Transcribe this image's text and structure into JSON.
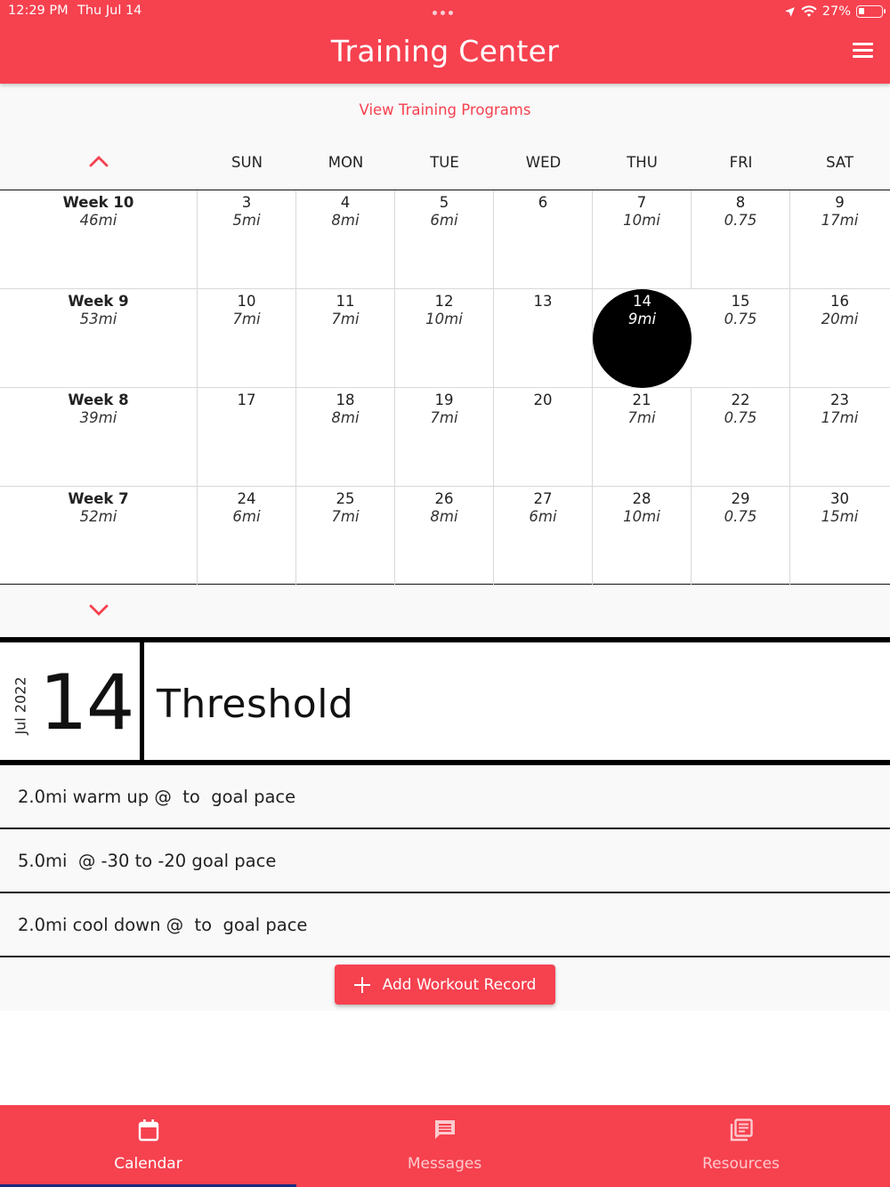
{
  "status_bar": {
    "time": "12:29 PM",
    "date": "Thu Jul 14",
    "battery": "27%"
  },
  "header": {
    "title": "Training Center",
    "menu_icon": "hamburger-menu-icon"
  },
  "calendar": {
    "view_programs_link": "View Training Programs",
    "days_of_week": [
      "SUN",
      "MON",
      "TUE",
      "WED",
      "THU",
      "FRI",
      "SAT"
    ],
    "weeks": [
      {
        "label": "Week 10",
        "total": "46mi",
        "days": [
          {
            "num": "3",
            "dist": "5mi"
          },
          {
            "num": "4",
            "dist": "8mi"
          },
          {
            "num": "5",
            "dist": "6mi"
          },
          {
            "num": "6",
            "dist": ""
          },
          {
            "num": "7",
            "dist": "10mi"
          },
          {
            "num": "8",
            "dist": "0.75"
          },
          {
            "num": "9",
            "dist": "17mi"
          }
        ]
      },
      {
        "label": "Week 9",
        "total": "53mi",
        "days": [
          {
            "num": "10",
            "dist": "7mi"
          },
          {
            "num": "11",
            "dist": "7mi"
          },
          {
            "num": "12",
            "dist": "10mi"
          },
          {
            "num": "13",
            "dist": ""
          },
          {
            "num": "14",
            "dist": "9mi",
            "selected": true
          },
          {
            "num": "15",
            "dist": "0.75"
          },
          {
            "num": "16",
            "dist": "20mi"
          }
        ]
      },
      {
        "label": "Week 8",
        "total": "39mi",
        "days": [
          {
            "num": "17",
            "dist": ""
          },
          {
            "num": "18",
            "dist": "8mi"
          },
          {
            "num": "19",
            "dist": "7mi"
          },
          {
            "num": "20",
            "dist": ""
          },
          {
            "num": "21",
            "dist": "7mi"
          },
          {
            "num": "22",
            "dist": "0.75"
          },
          {
            "num": "23",
            "dist": "17mi"
          }
        ]
      },
      {
        "label": "Week 7",
        "total": "52mi",
        "days": [
          {
            "num": "24",
            "dist": "6mi"
          },
          {
            "num": "25",
            "dist": "7mi"
          },
          {
            "num": "26",
            "dist": "8mi"
          },
          {
            "num": "27",
            "dist": "6mi"
          },
          {
            "num": "28",
            "dist": "10mi"
          },
          {
            "num": "29",
            "dist": "0.75"
          },
          {
            "num": "30",
            "dist": "15mi"
          }
        ]
      }
    ]
  },
  "detail": {
    "month_year": "Jul 2022",
    "day": "14",
    "workout_title": "Threshold",
    "steps": [
      "2.0mi warm up @  to  goal pace",
      "5.0mi  @ -30 to -20 goal pace",
      "2.0mi cool down @  to  goal pace"
    ],
    "add_button_label": "Add Workout Record"
  },
  "bottom_nav": {
    "items": [
      {
        "label": "Calendar",
        "icon": "calendar-icon",
        "active": true
      },
      {
        "label": "Messages",
        "icon": "message-icon",
        "active": false
      },
      {
        "label": "Resources",
        "icon": "resources-icon",
        "active": false
      }
    ]
  },
  "colors": {
    "brand": "#f6414f",
    "selected_day": "#000000",
    "nav_indicator": "#1a2a80"
  }
}
